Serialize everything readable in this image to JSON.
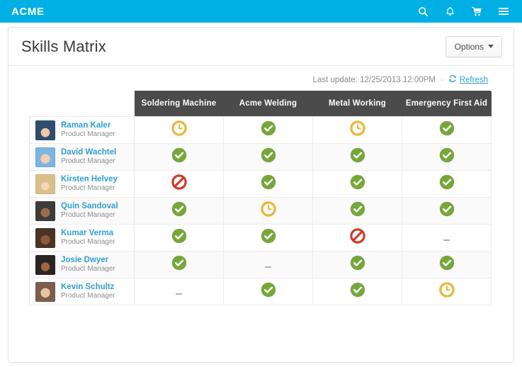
{
  "topbar": {
    "brand": "ACME",
    "brand_color": "#00b0e4",
    "icons": [
      {
        "name": "search-icon",
        "label": "Search"
      },
      {
        "name": "bell-icon",
        "label": "Notifications"
      },
      {
        "name": "cart-icon",
        "label": "Cart"
      },
      {
        "name": "hamburger-menu-icon",
        "label": "Menu"
      }
    ]
  },
  "card": {
    "title": "Skills Matrix",
    "options_label": "Options"
  },
  "update": {
    "text": "Last update: 12/25/2013 12:00PM",
    "separator": "-",
    "refresh_label": "Refresh",
    "link_color": "#2f9fd0"
  },
  "matrix": {
    "header_bg": "#4b4b4b",
    "columns": [
      "Soldering Machine",
      "Acme Welding",
      "Metal Working",
      "Emergency First Aid"
    ],
    "status_colors": {
      "check": "#76a838",
      "clock": "#e9b93f",
      "ban": "#cf3c2c",
      "none": "#b4b4b4"
    },
    "rows": [
      {
        "name": "Raman Kaler",
        "role": "Product Manager",
        "avatar": "av0",
        "values": [
          "clock",
          "check",
          "clock",
          "check"
        ]
      },
      {
        "name": "David Wachtel",
        "role": "Product Manager",
        "avatar": "av1",
        "values": [
          "check",
          "check",
          "check",
          "check"
        ]
      },
      {
        "name": "Kirsten Helvey",
        "role": "Product Manager",
        "avatar": "av2",
        "values": [
          "ban",
          "check",
          "check",
          "check"
        ]
      },
      {
        "name": "Quin Sandoval",
        "role": "Product Manager",
        "avatar": "av3",
        "values": [
          "check",
          "clock",
          "check",
          "check"
        ]
      },
      {
        "name": "Kumar Verma",
        "role": "Product Manager",
        "avatar": "av4",
        "values": [
          "check",
          "check",
          "ban",
          "none"
        ]
      },
      {
        "name": "Josie Dwyer",
        "role": "Product Manager",
        "avatar": "av5",
        "values": [
          "check",
          "none",
          "check",
          "check"
        ]
      },
      {
        "name": "Kevin Schultz",
        "role": "Product Manager",
        "avatar": "av6",
        "values": [
          "none",
          "check",
          "check",
          "clock"
        ]
      }
    ]
  }
}
